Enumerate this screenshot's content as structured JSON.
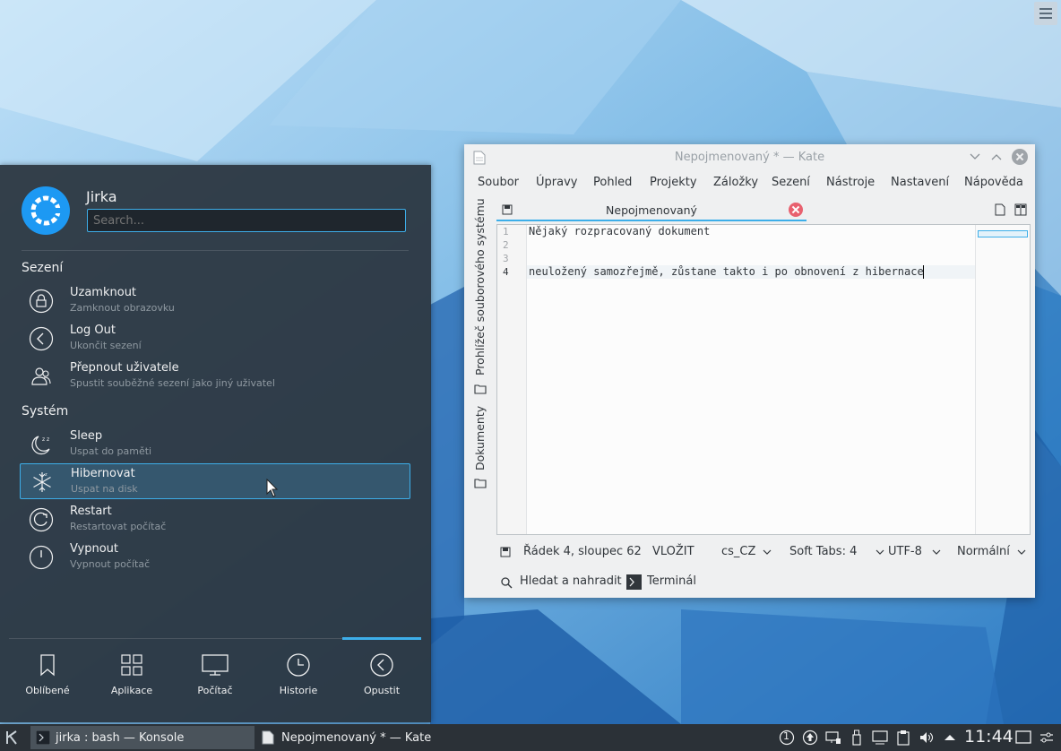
{
  "launcher": {
    "username": "Jirka",
    "search_placeholder": "Search...",
    "session_title": "Sezení",
    "system_title": "Systém",
    "session_actions": [
      {
        "label": "Uzamknout",
        "sub": "Zamknout obrazovku",
        "icon": "lock-icon"
      },
      {
        "label": "Log Out",
        "sub": "Ukončit sezení",
        "icon": "logout-icon"
      },
      {
        "label": "Přepnout uživatele",
        "sub": "Spustit souběžné sezení jako jiný uživatel",
        "icon": "switch-user-icon"
      }
    ],
    "system_actions": [
      {
        "label": "Sleep",
        "sub": "Uspat do paměti",
        "icon": "sleep-moon-icon"
      },
      {
        "label": "Hibernovat",
        "sub": "Uspat na disk",
        "icon": "snowflake-icon"
      },
      {
        "label": "Restart",
        "sub": "Restartovat počítač",
        "icon": "restart-icon"
      },
      {
        "label": "Vypnout",
        "sub": "Vypnout počítač",
        "icon": "power-icon"
      }
    ],
    "tabs": [
      {
        "label": "Oblíbené",
        "icon": "bookmark-icon"
      },
      {
        "label": "Aplikace",
        "icon": "apps-grid-icon"
      },
      {
        "label": "Počítač",
        "icon": "monitor-icon"
      },
      {
        "label": "Historie",
        "icon": "clock-icon"
      },
      {
        "label": "Opustit",
        "icon": "back-circle-icon"
      }
    ],
    "active_tab": "Opustit"
  },
  "kate": {
    "title": "Nepojmenovaný * — Kate",
    "menu": [
      "Soubor",
      "Úpravy",
      "Pohled",
      "Projekty",
      "Záložky",
      "Sezení",
      "Nástroje",
      "Nastavení",
      "Nápověda"
    ],
    "sidebar_tabs": [
      "Dokumenty",
      "Prohlížeč souborového systému"
    ],
    "doc_tab": "Nepojmenovaný",
    "lines": [
      {
        "n": "1",
        "text": "Nějaký rozpracovaný dokument"
      },
      {
        "n": "2",
        "text": ""
      },
      {
        "n": "3",
        "text": ""
      },
      {
        "n": "4",
        "text": "neuložený samozřejmě, zůstane takto i po obnovení z hibernace"
      }
    ],
    "status": {
      "position": "Řádek 4, sloupec 62",
      "mode": "VLOŽIT",
      "language": "cs_CZ",
      "tabs": "Soft Tabs: 4",
      "encoding": "UTF-8",
      "highlight": "Normální"
    },
    "bottom": {
      "search": "Hledat a nahradit",
      "terminal": "Terminál"
    }
  },
  "taskbar": {
    "tasks": [
      {
        "label": "jirka : bash — Konsole",
        "active": true
      },
      {
        "label": "Nepojmenovaný * — Kate",
        "active": false
      }
    ],
    "clock": "11:44",
    "tray_badge": "1"
  },
  "colors": {
    "accent": "#3daee9",
    "launcher_bg": "#28323c",
    "taskbar_bg": "#2b3137",
    "close_red": "#e8616f"
  }
}
